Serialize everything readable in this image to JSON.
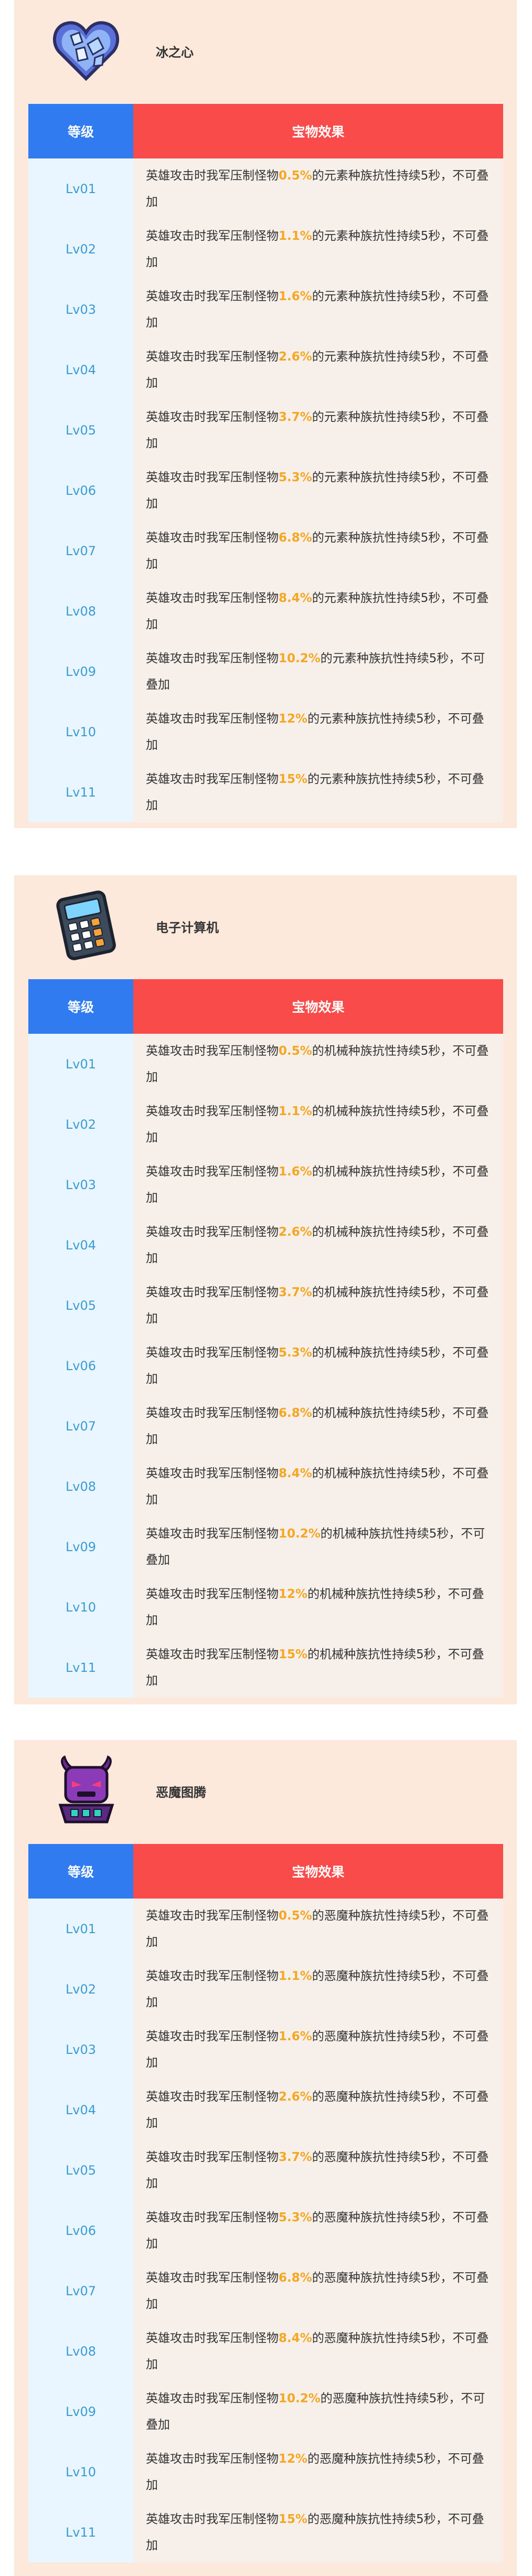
{
  "table_header": {
    "level": "等级",
    "effect": "宝物效果"
  },
  "cards": [
    {
      "title": "冰之心",
      "icon": "ice-heart-icon",
      "race": "元素种族",
      "rows": [
        {
          "level": "Lv01",
          "pre": "英雄攻击时我军压制怪物",
          "value": "0.5%",
          "post": "的元素种族抗性持续5秒，不可叠加"
        },
        {
          "level": "Lv02",
          "pre": "英雄攻击时我军压制怪物",
          "value": "1.1%",
          "post": "的元素种族抗性持续5秒，不可叠加"
        },
        {
          "level": "Lv03",
          "pre": "英雄攻击时我军压制怪物",
          "value": "1.6%",
          "post": "的元素种族抗性持续5秒，不可叠加"
        },
        {
          "level": "Lv04",
          "pre": "英雄攻击时我军压制怪物",
          "value": "2.6%",
          "post": "的元素种族抗性持续5秒，不可叠加"
        },
        {
          "level": "Lv05",
          "pre": "英雄攻击时我军压制怪物",
          "value": "3.7%",
          "post": "的元素种族抗性持续5秒，不可叠加"
        },
        {
          "level": "Lv06",
          "pre": "英雄攻击时我军压制怪物",
          "value": "5.3%",
          "post": "的元素种族抗性持续5秒，不可叠加"
        },
        {
          "level": "Lv07",
          "pre": "英雄攻击时我军压制怪物",
          "value": "6.8%",
          "post": "的元素种族抗性持续5秒，不可叠加"
        },
        {
          "level": "Lv08",
          "pre": "英雄攻击时我军压制怪物",
          "value": "8.4%",
          "post": "的元素种族抗性持续5秒，不可叠加"
        },
        {
          "level": "Lv09",
          "pre": "英雄攻击时我军压制怪物",
          "value": "10.2%",
          "post": "的元素种族抗性持续5秒，不可叠加"
        },
        {
          "level": "Lv10",
          "pre": "英雄攻击时我军压制怪物",
          "value": "12%",
          "post": "的元素种族抗性持续5秒，不可叠加"
        },
        {
          "level": "Lv11",
          "pre": "英雄攻击时我军压制怪物",
          "value": "15%",
          "post": "的元素种族抗性持续5秒，不可叠加"
        }
      ]
    },
    {
      "title": "电子计算机",
      "icon": "calculator-icon",
      "race": "机械种族",
      "rows": [
        {
          "level": "Lv01",
          "pre": "英雄攻击时我军压制怪物",
          "value": "0.5%",
          "post": "的机械种族抗性持续5秒，不可叠加"
        },
        {
          "level": "Lv02",
          "pre": "英雄攻击时我军压制怪物",
          "value": "1.1%",
          "post": "的机械种族抗性持续5秒，不可叠加"
        },
        {
          "level": "Lv03",
          "pre": "英雄攻击时我军压制怪物",
          "value": "1.6%",
          "post": "的机械种族抗性持续5秒，不可叠加"
        },
        {
          "level": "Lv04",
          "pre": "英雄攻击时我军压制怪物",
          "value": "2.6%",
          "post": "的机械种族抗性持续5秒，不可叠加"
        },
        {
          "level": "Lv05",
          "pre": "英雄攻击时我军压制怪物",
          "value": "3.7%",
          "post": "的机械种族抗性持续5秒，不可叠加"
        },
        {
          "level": "Lv06",
          "pre": "英雄攻击时我军压制怪物",
          "value": "5.3%",
          "post": "的机械种族抗性持续5秒，不可叠加"
        },
        {
          "level": "Lv07",
          "pre": "英雄攻击时我军压制怪物",
          "value": "6.8%",
          "post": "的机械种族抗性持续5秒，不可叠加"
        },
        {
          "level": "Lv08",
          "pre": "英雄攻击时我军压制怪物",
          "value": "8.4%",
          "post": "的机械种族抗性持续5秒，不可叠加"
        },
        {
          "level": "Lv09",
          "pre": "英雄攻击时我军压制怪物",
          "value": "10.2%",
          "post": "的机械种族抗性持续5秒，不可叠加"
        },
        {
          "level": "Lv10",
          "pre": "英雄攻击时我军压制怪物",
          "value": "12%",
          "post": "的机械种族抗性持续5秒，不可叠加"
        },
        {
          "level": "Lv11",
          "pre": "英雄攻击时我军压制怪物",
          "value": "15%",
          "post": "的机械种族抗性持续5秒，不可叠加"
        }
      ]
    },
    {
      "title": "恶魔图腾",
      "icon": "demon-totem-icon",
      "race": "恶魔种族",
      "rows": [
        {
          "level": "Lv01",
          "pre": "英雄攻击时我军压制怪物",
          "value": "0.5%",
          "post": "的恶魔种族抗性持续5秒，不可叠加"
        },
        {
          "level": "Lv02",
          "pre": "英雄攻击时我军压制怪物",
          "value": "1.1%",
          "post": "的恶魔种族抗性持续5秒，不可叠加"
        },
        {
          "level": "Lv03",
          "pre": "英雄攻击时我军压制怪物",
          "value": "1.6%",
          "post": "的恶魔种族抗性持续5秒，不可叠加"
        },
        {
          "level": "Lv04",
          "pre": "英雄攻击时我军压制怪物",
          "value": "2.6%",
          "post": "的恶魔种族抗性持续5秒，不可叠加"
        },
        {
          "level": "Lv05",
          "pre": "英雄攻击时我军压制怪物",
          "value": "3.7%",
          "post": "的恶魔种族抗性持续5秒，不可叠加"
        },
        {
          "level": "Lv06",
          "pre": "英雄攻击时我军压制怪物",
          "value": "5.3%",
          "post": "的恶魔种族抗性持续5秒，不可叠加"
        },
        {
          "level": "Lv07",
          "pre": "英雄攻击时我军压制怪物",
          "value": "6.8%",
          "post": "的恶魔种族抗性持续5秒，不可叠加"
        },
        {
          "level": "Lv08",
          "pre": "英雄攻击时我军压制怪物",
          "value": "8.4%",
          "post": "的恶魔种族抗性持续5秒，不可叠加"
        },
        {
          "level": "Lv09",
          "pre": "英雄攻击时我军压制怪物",
          "value": "10.2%",
          "post": "的恶魔种族抗性持续5秒，不可叠加"
        },
        {
          "level": "Lv10",
          "pre": "英雄攻击时我军压制怪物",
          "value": "12%",
          "post": "的恶魔种族抗性持续5秒，不可叠加"
        },
        {
          "level": "Lv11",
          "pre": "英雄攻击时我军压制怪物",
          "value": "15%",
          "post": "的恶魔种族抗性持续5秒，不可叠加"
        }
      ]
    }
  ],
  "colors": {
    "card_bg": "#fde8dc",
    "level_header": "#2f7bef",
    "effect_header": "#f94b4a",
    "level_cell": "#e9f6ff",
    "effect_cell": "#f7efe9",
    "value_highlight": "#f5a623"
  }
}
